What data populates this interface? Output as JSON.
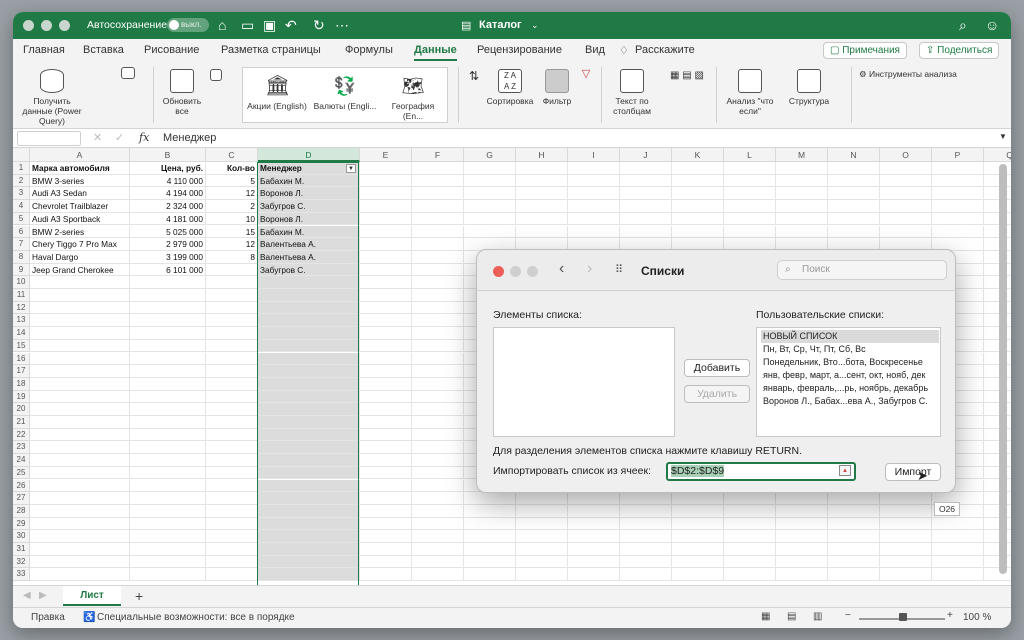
{
  "titlebar": {
    "autosave_label": "Автосохранение",
    "autosave_state": "выкл.",
    "doc_title": "Каталог",
    "accent": "#1f7a45"
  },
  "tabs": [
    {
      "label": "Главная"
    },
    {
      "label": "Вставка"
    },
    {
      "label": "Рисование"
    },
    {
      "label": "Разметка страницы"
    },
    {
      "label": "Формулы"
    },
    {
      "label": "Данные",
      "active": true
    },
    {
      "label": "Рецензирование"
    },
    {
      "label": "Вид"
    },
    {
      "label": "Расскажите"
    }
  ],
  "header_actions": {
    "comments": "Примечания",
    "share": "Поделиться"
  },
  "ribbon": {
    "get_data": "Получить данные (Power Query)",
    "refresh_all": "Обновить все",
    "stocks": "Акции (English)",
    "currencies": "Валюты (Engli...",
    "geography": "География (En...",
    "sort": "Сортировка",
    "filter": "Фильтр",
    "text_to_columns": "Текст по столбцам",
    "what_if": "Анализ \"что если\"",
    "outline": "Структура",
    "analysis_tools": "Инструменты анализа"
  },
  "formula_bar": {
    "fx": "fx",
    "value": "Менеджер"
  },
  "grid": {
    "columns": [
      "A",
      "B",
      "C",
      "D",
      "E",
      "F",
      "G",
      "H",
      "I",
      "J",
      "K",
      "L",
      "M",
      "N",
      "O",
      "P",
      "Q"
    ],
    "selected_column": "D",
    "rows_visible": 33,
    "headers": [
      "Марка автомобиля",
      "Цена, руб.",
      "Кол-во",
      "Менеджер"
    ],
    "rows": [
      [
        "BMW 3-series",
        "4 110 000",
        "5",
        "Бабахин М."
      ],
      [
        "Audi A3 Sedan",
        "4 194 000",
        "12",
        "Воронов Л."
      ],
      [
        "Chevrolet Trailblazer",
        "2 324 000",
        "2",
        "Забугров С."
      ],
      [
        "Audi A3 Sportback",
        "4 181 000",
        "10",
        "Воронов Л."
      ],
      [
        "BMW 2-series",
        "5 025 000",
        "15",
        "Бабахин М."
      ],
      [
        "Chery Tiggo 7 Pro Max",
        "2 979 000",
        "12",
        "Валентьева А."
      ],
      [
        "Haval Dargo",
        "3 199 000",
        "8",
        "Валентьева А."
      ],
      [
        "Jeep Grand Cherokee",
        "6 101 000",
        "",
        "Забугров С."
      ]
    ]
  },
  "sheet": {
    "tab": "Лист",
    "add": "+"
  },
  "status": {
    "ready": "Правка",
    "accessibility": "Специальные возможности: все в порядке",
    "zoom": "100 %"
  },
  "dialog": {
    "title": "Списки",
    "search_placeholder": "Поиск",
    "list_entries_label": "Элементы списка:",
    "custom_lists_label": "Пользовательские списки:",
    "custom_lists": [
      "НОВЫЙ СПИСОК",
      "Пн, Вт, Ср, Чт, Пт, Сб, Вс",
      "Понедельник, Вто...бота, Воскресенье",
      "янв, февр, март, а...сент, окт, нояб, дек",
      "январь, февраль,...рь, ноябрь, декабрь",
      "Воронов Л., Бабах...ева А., Забугров С."
    ],
    "add_button": "Добавить",
    "delete_button": "Удалить",
    "hint": "Для разделения элементов списка нажмите клавишу RETURN.",
    "import_label": "Импортировать список из ячеек:",
    "import_range": "$D$2:$D$9",
    "import_button": "Импорт"
  },
  "tooltip": "O26"
}
